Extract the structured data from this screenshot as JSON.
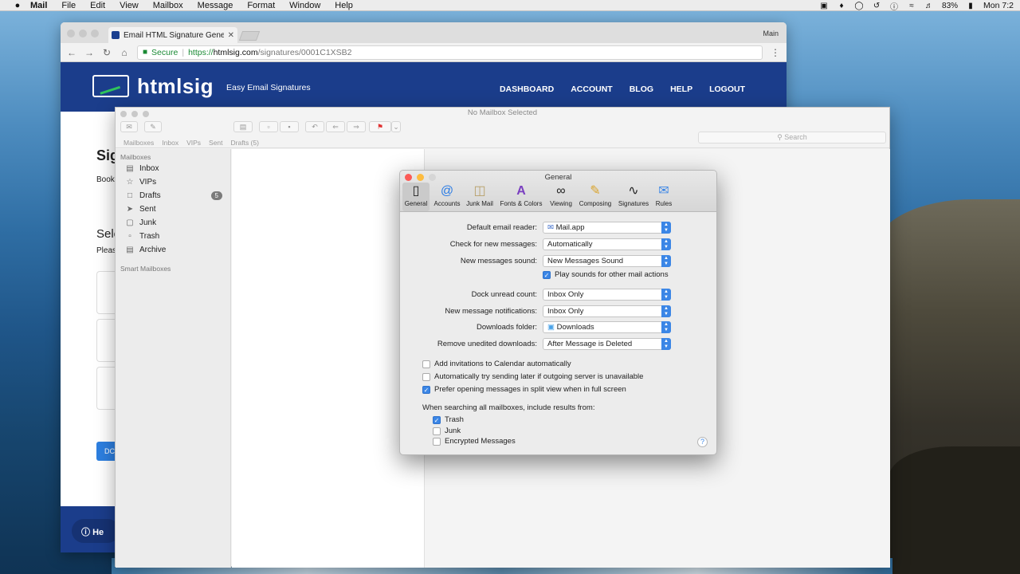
{
  "menubar": {
    "app": "Mail",
    "items": [
      "File",
      "Edit",
      "View",
      "Mailbox",
      "Message",
      "Format",
      "Window",
      "Help"
    ],
    "battery": "83%",
    "clock": "Mon 7:2"
  },
  "chrome": {
    "tab_title": "Email HTML Signature Generat",
    "profile": "Main",
    "secure": "Secure",
    "url_scheme": "https://",
    "url_host": "htmlsig.com",
    "url_path": "/signatures/0001C1XSB2"
  },
  "site": {
    "logo": "htmlsig",
    "tagline": "Easy Email Signatures",
    "nav": [
      "DASHBOARD",
      "ACCOUNT",
      "BLOG",
      "HELP",
      "LOGOUT"
    ],
    "ghost_title": "Sig",
    "ghost_book": "Book",
    "ghost_select": "Sele",
    "ghost_please": "Pleas",
    "ghost_btn": "DC",
    "help_pill": "He"
  },
  "mail": {
    "title": "No Mailbox Selected",
    "search_placeholder": "Search",
    "favbar": [
      "Mailboxes",
      "Inbox",
      "VIPs",
      "Sent",
      "Drafts (5)"
    ],
    "sidebar_header": "Mailboxes",
    "smart_header": "Smart Mailboxes",
    "mailboxes": [
      {
        "label": "Inbox",
        "icon": "inbox-icon"
      },
      {
        "label": "VIPs",
        "icon": "star-icon"
      },
      {
        "label": "Drafts",
        "icon": "drafts-icon",
        "badge": "5"
      },
      {
        "label": "Sent",
        "icon": "sent-icon"
      },
      {
        "label": "Junk",
        "icon": "junk-icon"
      },
      {
        "label": "Trash",
        "icon": "trash-icon"
      },
      {
        "label": "Archive",
        "icon": "archive-icon"
      }
    ]
  },
  "prefs": {
    "title": "General",
    "tabs": [
      "General",
      "Accounts",
      "Junk Mail",
      "Fonts & Colors",
      "Viewing",
      "Composing",
      "Signatures",
      "Rules"
    ],
    "fields": [
      {
        "label": "Default email reader:",
        "value": "Mail.app"
      },
      {
        "label": "Check for new messages:",
        "value": "Automatically"
      },
      {
        "label": "New messages sound:",
        "value": "New Messages Sound"
      },
      {
        "label": "Dock unread count:",
        "value": "Inbox Only"
      },
      {
        "label": "New message notifications:",
        "value": "Inbox Only"
      },
      {
        "label": "Downloads folder:",
        "value": "Downloads"
      },
      {
        "label": "Remove unedited downloads:",
        "value": "After Message is Deleted"
      }
    ],
    "play_sounds": "Play sounds for other mail actions",
    "checks": [
      "Add invitations to Calendar automatically",
      "Automatically try sending later if outgoing server is unavailable",
      "Prefer opening messages in split view when in full screen"
    ],
    "search_heading": "When searching all mailboxes, include results from:",
    "search_opts": [
      "Trash",
      "Junk",
      "Encrypted Messages"
    ],
    "help": "?"
  }
}
